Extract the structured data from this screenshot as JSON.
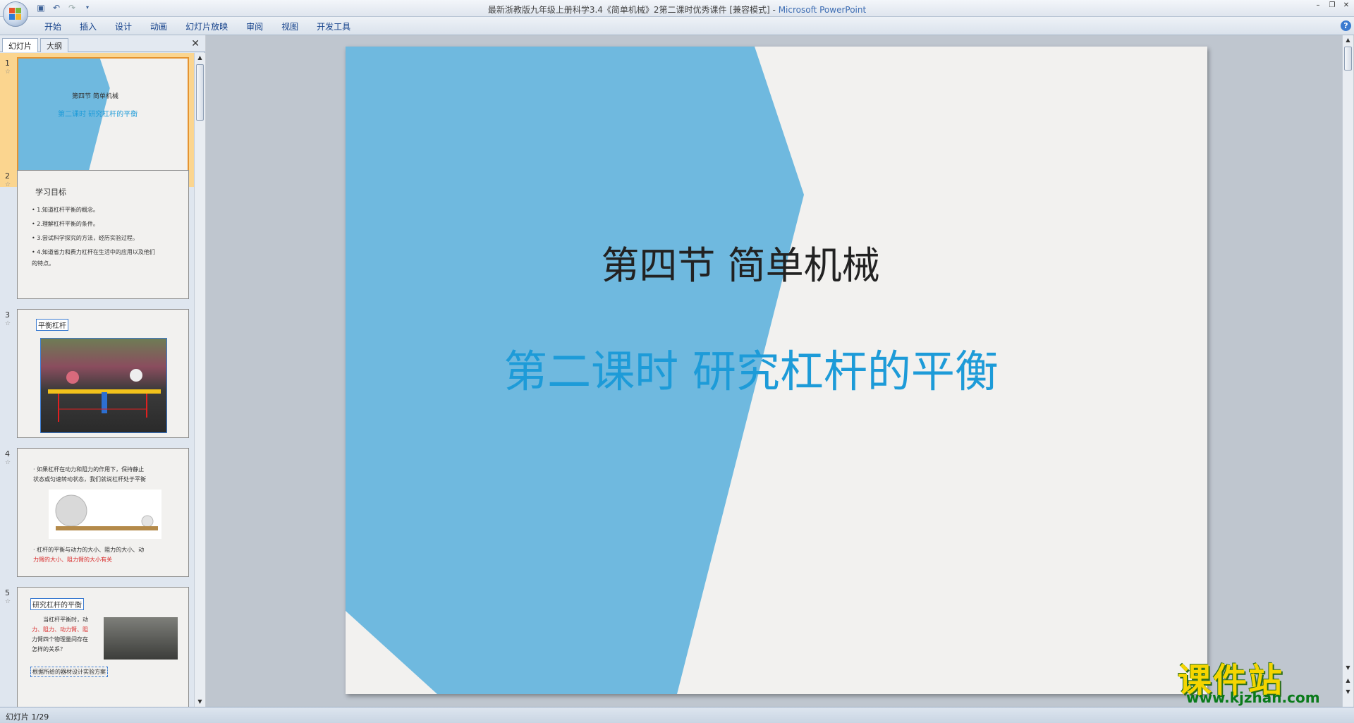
{
  "window": {
    "title": "最新浙教版九年级上册科学3.4《简单机械》2第二课时优秀课件 [兼容模式] -",
    "app_name": "Microsoft PowerPoint"
  },
  "ribbon": {
    "tabs": [
      "开始",
      "插入",
      "设计",
      "动画",
      "幻灯片放映",
      "审阅",
      "视图",
      "开发工具"
    ]
  },
  "left_pane": {
    "tabs": [
      "幻灯片",
      "大纲"
    ],
    "close_glyph": "✕",
    "thumbnails": [
      {
        "number": "1",
        "title": "第四节  简单机械",
        "subtitle": "第二课时 研究杠杆的平衡"
      },
      {
        "number": "2",
        "heading": "学习目标",
        "bullets": [
          "• 1.知道杠杆平衡的概念。",
          "• 2.理解杠杆平衡的条件。",
          "• 3.尝试科学探究的方法，经历实验过程。",
          "• 4.知道省力和费力杠杆在生活中的应用以及他们",
          "   的特点。"
        ]
      },
      {
        "number": "3",
        "heading": "平衡杠杆"
      },
      {
        "number": "4",
        "line1": "· 如果杠杆在动力和阻力的作用下，保持静止",
        "line2": "状态或匀速转动状态，我们就说杠杆处于平衡",
        "line3": "· 杠杆的平衡与动力的大小、阻力的大小、动",
        "line4": "力臂的大小、阻力臂的大小有关"
      },
      {
        "number": "5",
        "heading": "研究杠杆的平衡",
        "text1": "当杠杆平衡时，动",
        "text2": "力、阻力、动力臂、阻",
        "text3": "力臂四个物理量间存在",
        "text4": "怎样的关系？",
        "text5": "根据所给的器材设计实验方案"
      }
    ]
  },
  "slide": {
    "title": "第四节  简单机械",
    "subtitle": "第二课时 研究杠杆的平衡",
    "colors": {
      "background": "#f2f1ef",
      "shape": "#6fb9df",
      "subtitle": "#1d9bd8"
    }
  },
  "status_bar": {
    "slide_info": "幻灯片 1/29"
  },
  "watermark": {
    "text": "课件站",
    "url": "www.kjzhan.com"
  }
}
